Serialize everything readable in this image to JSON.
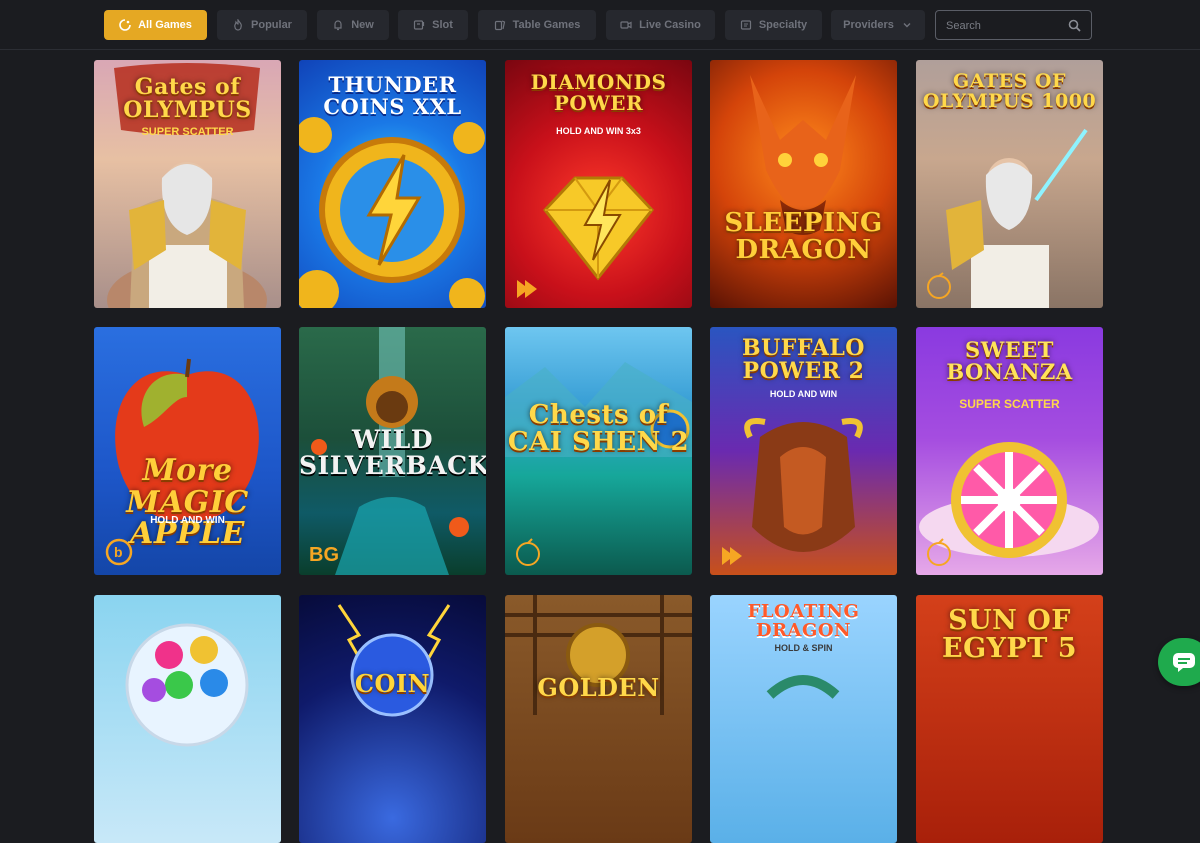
{
  "nav": {
    "tabs": [
      {
        "label": "All Games",
        "icon": "sparkle-icon",
        "active": true
      },
      {
        "label": "Popular",
        "icon": "flame-icon",
        "active": false
      },
      {
        "label": "New",
        "icon": "bell-icon",
        "active": false
      },
      {
        "label": "Slot",
        "icon": "slot-machine-icon",
        "active": false
      },
      {
        "label": "Table Games",
        "icon": "cards-icon",
        "active": false
      },
      {
        "label": "Live Casino",
        "icon": "video-icon",
        "active": false
      },
      {
        "label": "Specialty",
        "icon": "ticket-icon",
        "active": false
      },
      {
        "label": "Providers",
        "icon": "chevron-down-icon",
        "active": false
      }
    ],
    "search_placeholder": "Search",
    "accent_color": "#e5a823"
  },
  "games": [
    {
      "title": "Gates of OLYMPUS",
      "subtitle": "SUPER SCATTER",
      "provider_icon": ""
    },
    {
      "title": "THUNDER COINS XXL",
      "subtitle": "",
      "provider_icon": ""
    },
    {
      "title": "DIAMONDS POWER",
      "subtitle": "HOLD AND WIN 3x3",
      "provider_icon": "triangles-logo-icon"
    },
    {
      "title": "SLEEPING DRAGON",
      "subtitle": "",
      "provider_icon": ""
    },
    {
      "title": "GATES OF OLYMPUS 1000",
      "subtitle": "",
      "provider_icon": "pragmatic-logo-icon"
    },
    {
      "title": "More MAGIC APPLE",
      "subtitle": "HOLD AND WIN",
      "provider_icon": "b-logo-icon"
    },
    {
      "title": "WILD SILVERBACK",
      "subtitle": "",
      "provider_icon": "bg-logo-icon"
    },
    {
      "title": "Chests of CAI SHEN 2",
      "subtitle": "",
      "provider_icon": "pragmatic-logo-icon"
    },
    {
      "title": "BUFFALO POWER 2",
      "subtitle": "HOLD AND WIN",
      "provider_icon": "triangles-logo-icon"
    },
    {
      "title": "SWEET BONANZA",
      "subtitle": "SUPER SCATTER",
      "provider_icon": "pragmatic-logo-icon"
    },
    {
      "title": "",
      "subtitle": "",
      "provider_icon": ""
    },
    {
      "title": "COIN",
      "subtitle": "",
      "provider_icon": ""
    },
    {
      "title": "GOLDEN",
      "subtitle": "",
      "provider_icon": ""
    },
    {
      "title": "FLOATING DRAGON",
      "subtitle": "HOLD & SPIN",
      "provider_icon": ""
    },
    {
      "title": "SUN OF EGYPT 5",
      "subtitle": "",
      "provider_icon": ""
    }
  ],
  "provider_labels": {
    "bg": "BG"
  },
  "chat": {
    "icon": "chat-bubble-icon",
    "color": "#1faa4d"
  }
}
